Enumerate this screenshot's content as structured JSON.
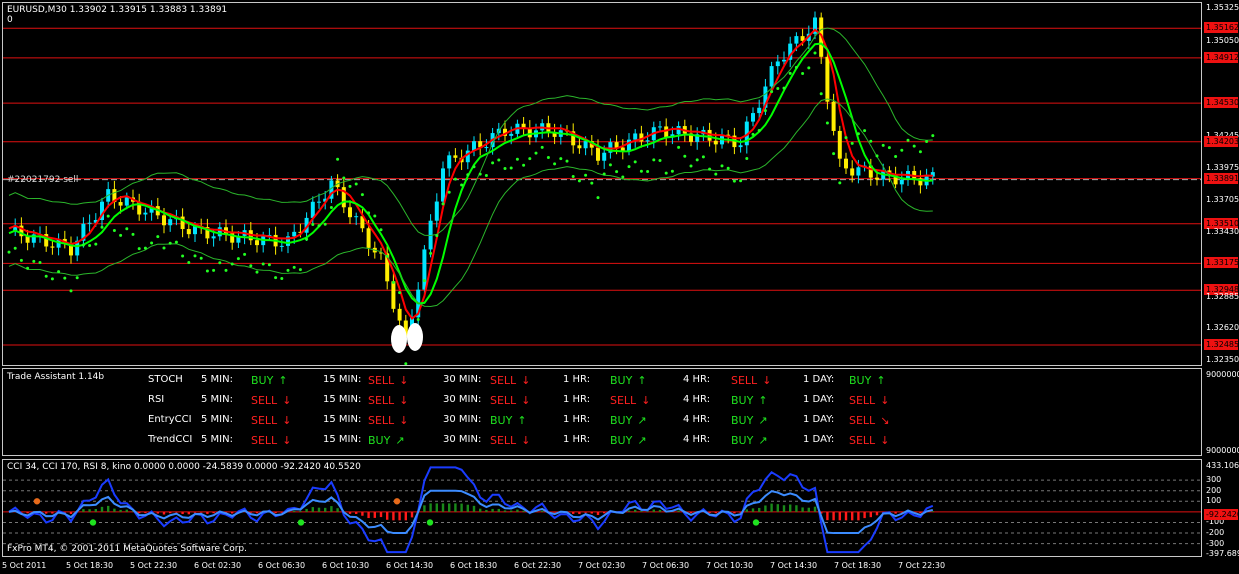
{
  "main_chart": {
    "title": "EURUSD,M30  1.33902 1.33915 1.33883 1.33891",
    "subtitle": "0",
    "order_label": "#22021792 sell",
    "price_levels": [
      {
        "label": "1.35325",
        "tag": false
      },
      {
        "label": "1.35162",
        "tag": true
      },
      {
        "label": "1.35050",
        "tag": false
      },
      {
        "label": "1.34912",
        "tag": true
      },
      {
        "label": "1.34530",
        "tag": true
      },
      {
        "label": "1.34245",
        "tag": false
      },
      {
        "label": "1.34203",
        "tag": true
      },
      {
        "label": "1.33975",
        "tag": false
      },
      {
        "label": "1.33891",
        "tag": true
      },
      {
        "label": "1.33705",
        "tag": false
      },
      {
        "label": "1.33510",
        "tag": true
      },
      {
        "label": "1.33430",
        "tag": false
      },
      {
        "label": "1.33175",
        "tag": true
      },
      {
        "label": "1.32948",
        "tag": true
      },
      {
        "label": "1.32885",
        "tag": false
      },
      {
        "label": "1.32620",
        "tag": false
      },
      {
        "label": "1.32485",
        "tag": true
      },
      {
        "label": "1.32350",
        "tag": false
      }
    ],
    "colors": {
      "bull": "#00e5ff",
      "bear": "#ffee00",
      "lines": "#e01010",
      "psar": "#22ff22",
      "bands": "#2bb52b",
      "ma_fast": "#ff0000",
      "ma_slow": "#00ff00"
    }
  },
  "trade_assistant": {
    "title": "Trade Assistant 1.14b",
    "axis_top": "9000000",
    "axis_bottom": "9000000",
    "rows": [
      {
        "name": "STOCH",
        "signals": [
          {
            "tf": "5 MIN:",
            "sig": "BUY",
            "dir": "buy",
            "arrow": "↑"
          },
          {
            "tf": "15 MIN:",
            "sig": "SELL",
            "dir": "sell",
            "arrow": "↓"
          },
          {
            "tf": "30 MIN:",
            "sig": "SELL",
            "dir": "sell",
            "arrow": "↓"
          },
          {
            "tf": "1 HR:",
            "sig": "BUY",
            "dir": "buy",
            "arrow": "↑"
          },
          {
            "tf": "4 HR:",
            "sig": "SELL",
            "dir": "sell",
            "arrow": "↓"
          },
          {
            "tf": "1 DAY:",
            "sig": "BUY",
            "dir": "buy",
            "arrow": "↑"
          }
        ]
      },
      {
        "name": "RSI",
        "signals": [
          {
            "tf": "5 MIN:",
            "sig": "SELL",
            "dir": "sell",
            "arrow": "↓"
          },
          {
            "tf": "15 MIN:",
            "sig": "SELL",
            "dir": "sell",
            "arrow": "↓"
          },
          {
            "tf": "30 MIN:",
            "sig": "SELL",
            "dir": "sell",
            "arrow": "↓"
          },
          {
            "tf": "1 HR:",
            "sig": "SELL",
            "dir": "sell",
            "arrow": "↓"
          },
          {
            "tf": "4 HR:",
            "sig": "BUY",
            "dir": "buy",
            "arrow": "↑"
          },
          {
            "tf": "1 DAY:",
            "sig": "SELL",
            "dir": "sell",
            "arrow": "↓"
          }
        ]
      },
      {
        "name": "EntryCCI",
        "signals": [
          {
            "tf": "5 MIN:",
            "sig": "SELL",
            "dir": "sell",
            "arrow": "↓"
          },
          {
            "tf": "15 MIN:",
            "sig": "SELL",
            "dir": "sell",
            "arrow": "↓"
          },
          {
            "tf": "30 MIN:",
            "sig": "BUY",
            "dir": "buy",
            "arrow": "↑"
          },
          {
            "tf": "1 HR:",
            "sig": "BUY",
            "dir": "buy",
            "arrow": "↗"
          },
          {
            "tf": "4 HR:",
            "sig": "BUY",
            "dir": "buy",
            "arrow": "↗"
          },
          {
            "tf": "1 DAY:",
            "sig": "SELL",
            "dir": "sell",
            "arrow": "↘"
          }
        ]
      },
      {
        "name": "TrendCCI",
        "signals": [
          {
            "tf": "5 MIN:",
            "sig": "SELL",
            "dir": "sell",
            "arrow": "↓"
          },
          {
            "tf": "15 MIN:",
            "sig": "BUY",
            "dir": "buy",
            "arrow": "↗"
          },
          {
            "tf": "30 MIN:",
            "sig": "SELL",
            "dir": "sell",
            "arrow": "↓"
          },
          {
            "tf": "1 HR:",
            "sig": "BUY",
            "dir": "buy",
            "arrow": "↗"
          },
          {
            "tf": "4 HR:",
            "sig": "BUY",
            "dir": "buy",
            "arrow": "↗"
          },
          {
            "tf": "1 DAY:",
            "sig": "SELL",
            "dir": "sell",
            "arrow": "↓"
          }
        ]
      }
    ]
  },
  "cci_panel": {
    "title": "CCI 34, CCI 170, RSI 8, kino  0.0000 0.0000 -24.5839 0.0000 -92.2420 40.5520",
    "levels": [
      "433.1061",
      "300",
      "200",
      "100",
      "-100",
      "-200",
      "-300",
      "-397.6897"
    ],
    "current_tag": "-92.2420",
    "copyright": "FxPro MT4, © 2001-2011 MetaQuotes Software Corp."
  },
  "time_axis": [
    "5 Oct 2011",
    "5 Oct 18:30",
    "5 Oct 22:30",
    "6 Oct 02:30",
    "6 Oct 06:30",
    "6 Oct 10:30",
    "6 Oct 14:30",
    "6 Oct 18:30",
    "6 Oct 22:30",
    "7 Oct 02:30",
    "7 Oct 06:30",
    "7 Oct 10:30",
    "7 Oct 14:30",
    "7 Oct 18:30",
    "7 Oct 22:30"
  ]
}
